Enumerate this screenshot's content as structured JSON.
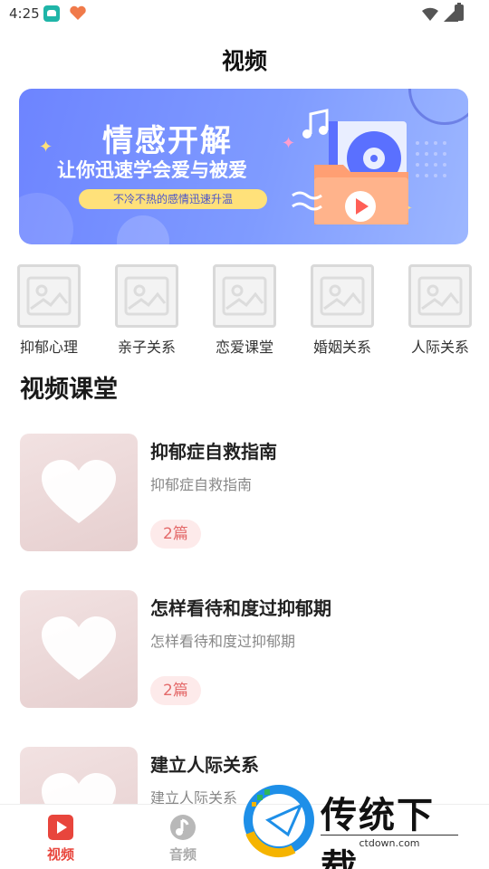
{
  "status": {
    "time": "4:25"
  },
  "page": {
    "title": "视频"
  },
  "banner": {
    "title": "情感开解",
    "subtitle": "让你迅速学会爱与被爱",
    "tag": "不冷不热的感情迅速升温",
    "colors": {
      "bg_start": "#6d84ff",
      "bg_end": "#9db7ff",
      "tag_bg": "#ffe17a"
    }
  },
  "categories": [
    {
      "label": "抑郁心理",
      "icon": "image-placeholder-icon"
    },
    {
      "label": "亲子关系",
      "icon": "image-placeholder-icon"
    },
    {
      "label": "恋爱课堂",
      "icon": "image-placeholder-icon"
    },
    {
      "label": "婚姻关系",
      "icon": "image-placeholder-icon"
    },
    {
      "label": "人际关系",
      "icon": "image-placeholder-icon"
    }
  ],
  "section": {
    "title": "视频课堂"
  },
  "courses": [
    {
      "title": "抑郁症自救指南",
      "description": "抑郁症自救指南",
      "count": "2篇",
      "icon": "heart-icon"
    },
    {
      "title": "怎样看待和度过抑郁期",
      "description": "怎样看待和度过抑郁期",
      "count": "2篇",
      "icon": "heart-icon"
    },
    {
      "title": "建立人际关系",
      "description": "建立人际关系",
      "count": "",
      "icon": "heart-icon"
    }
  ],
  "bottom_nav": [
    {
      "label": "视频",
      "icon": "video-play-icon",
      "active": true,
      "color": "#e8453c"
    },
    {
      "label": "音频",
      "icon": "music-note-icon",
      "active": false,
      "color": "#aaaaaa"
    }
  ],
  "watermark": {
    "name": "传统下载",
    "url": "ctdown.com"
  }
}
